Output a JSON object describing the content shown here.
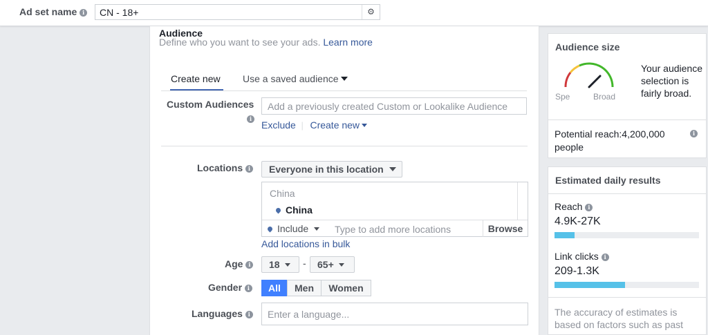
{
  "header": {
    "adset_label": "Ad set name",
    "adset_value": "CN - 18+"
  },
  "audience": {
    "title": "Audience",
    "subtitle": "Define who you want to see your ads.",
    "learn_more": "Learn more",
    "tabs": [
      {
        "label": "Create new",
        "active": true
      },
      {
        "label": "Use a saved audience",
        "active": false
      }
    ]
  },
  "custom_audiences": {
    "label": "Custom Audiences",
    "placeholder": "Add a previously created Custom or Lookalike Audience",
    "exclude": "Exclude",
    "create_new": "Create new"
  },
  "locations": {
    "label": "Locations",
    "dropdown": "Everyone in this location",
    "country_header": "China",
    "selected": "China",
    "include": "Include",
    "placeholder": "Type to add more locations",
    "browse": "Browse",
    "bulk": "Add locations in bulk"
  },
  "age": {
    "label": "Age",
    "min": "18",
    "max": "65+",
    "separator": "-"
  },
  "gender": {
    "label": "Gender",
    "options": [
      "All",
      "Men",
      "Women"
    ],
    "selected": "All"
  },
  "languages": {
    "label": "Languages",
    "placeholder": "Enter a language..."
  },
  "audience_size": {
    "title": "Audience size",
    "description": "Your audience selection is fairly broad.",
    "specific_label": "Spe",
    "broad_label": "Broad",
    "potential_reach": "Potential reach:4,200,000 people"
  },
  "estimated": {
    "title": "Estimated daily results",
    "reach_label": "Reach",
    "reach_value": "4.9K-27K",
    "reach_fill": 0.14,
    "clicks_label": "Link clicks",
    "clicks_value": "209-1.3K",
    "clicks_fill": 0.49,
    "note": "The accuracy of estimates is based on factors such as past"
  },
  "colors": {
    "accent": "#4267b2",
    "link": "#365899",
    "gender_active": "#4080ff",
    "bar_fill": "#56c1e8",
    "gauge_red": "#d0383b",
    "gauge_yellow": "#f5c33b",
    "gauge_green": "#42b72a"
  }
}
